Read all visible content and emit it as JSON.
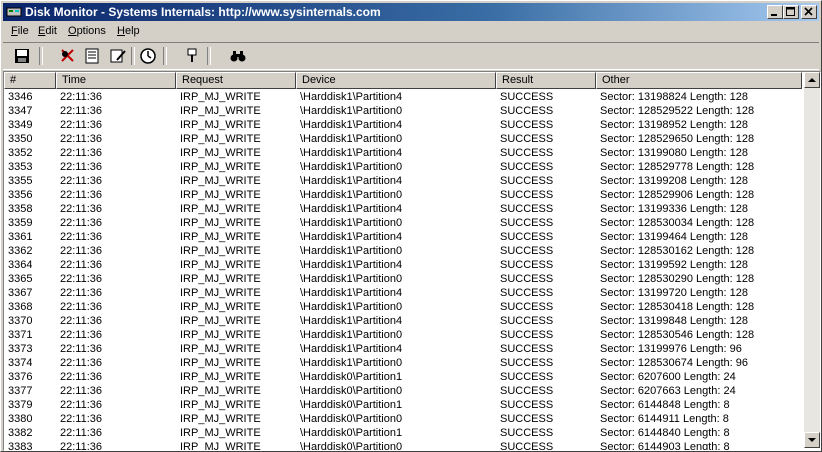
{
  "window": {
    "title": "Disk Monitor - Systems Internals: http://www.sysinternals.com"
  },
  "menu": [
    {
      "label": "File",
      "accel": "F",
      "rest": "ile"
    },
    {
      "label": "Edit",
      "accel": "E",
      "rest": "dit"
    },
    {
      "label": "Options",
      "accel": "O",
      "rest": "ptions"
    },
    {
      "label": "Help",
      "accel": "H",
      "rest": "elp"
    }
  ],
  "toolbar": [
    "save-icon",
    "capture-icon",
    "autoscroll-icon",
    "clear-icon",
    "time-icon",
    "filter-icon",
    "find-icon"
  ],
  "columns": [
    "#",
    "Time",
    "Request",
    "Device",
    "Result",
    "Other"
  ],
  "rows": [
    [
      "3346",
      "22:11:36",
      "IRP_MJ_WRITE",
      "\\Harddisk1\\Partition4",
      "SUCCESS",
      "Sector: 13198824  Length: 128"
    ],
    [
      "3347",
      "22:11:36",
      "IRP_MJ_WRITE",
      "\\Harddisk1\\Partition0",
      "SUCCESS",
      "Sector: 128529522  Length: 128"
    ],
    [
      "3349",
      "22:11:36",
      "IRP_MJ_WRITE",
      "\\Harddisk1\\Partition4",
      "SUCCESS",
      "Sector: 13198952  Length: 128"
    ],
    [
      "3350",
      "22:11:36",
      "IRP_MJ_WRITE",
      "\\Harddisk1\\Partition0",
      "SUCCESS",
      "Sector: 128529650  Length: 128"
    ],
    [
      "3352",
      "22:11:36",
      "IRP_MJ_WRITE",
      "\\Harddisk1\\Partition4",
      "SUCCESS",
      "Sector: 13199080  Length: 128"
    ],
    [
      "3353",
      "22:11:36",
      "IRP_MJ_WRITE",
      "\\Harddisk1\\Partition0",
      "SUCCESS",
      "Sector: 128529778  Length: 128"
    ],
    [
      "3355",
      "22:11:36",
      "IRP_MJ_WRITE",
      "\\Harddisk1\\Partition4",
      "SUCCESS",
      "Sector: 13199208  Length: 128"
    ],
    [
      "3356",
      "22:11:36",
      "IRP_MJ_WRITE",
      "\\Harddisk1\\Partition0",
      "SUCCESS",
      "Sector: 128529906  Length: 128"
    ],
    [
      "3358",
      "22:11:36",
      "IRP_MJ_WRITE",
      "\\Harddisk1\\Partition4",
      "SUCCESS",
      "Sector: 13199336  Length: 128"
    ],
    [
      "3359",
      "22:11:36",
      "IRP_MJ_WRITE",
      "\\Harddisk1\\Partition0",
      "SUCCESS",
      "Sector: 128530034  Length: 128"
    ],
    [
      "3361",
      "22:11:36",
      "IRP_MJ_WRITE",
      "\\Harddisk1\\Partition4",
      "SUCCESS",
      "Sector: 13199464  Length: 128"
    ],
    [
      "3362",
      "22:11:36",
      "IRP_MJ_WRITE",
      "\\Harddisk1\\Partition0",
      "SUCCESS",
      "Sector: 128530162  Length: 128"
    ],
    [
      "3364",
      "22:11:36",
      "IRP_MJ_WRITE",
      "\\Harddisk1\\Partition4",
      "SUCCESS",
      "Sector: 13199592  Length: 128"
    ],
    [
      "3365",
      "22:11:36",
      "IRP_MJ_WRITE",
      "\\Harddisk1\\Partition0",
      "SUCCESS",
      "Sector: 128530290  Length: 128"
    ],
    [
      "3367",
      "22:11:36",
      "IRP_MJ_WRITE",
      "\\Harddisk1\\Partition4",
      "SUCCESS",
      "Sector: 13199720  Length: 128"
    ],
    [
      "3368",
      "22:11:36",
      "IRP_MJ_WRITE",
      "\\Harddisk1\\Partition0",
      "SUCCESS",
      "Sector: 128530418  Length: 128"
    ],
    [
      "3370",
      "22:11:36",
      "IRP_MJ_WRITE",
      "\\Harddisk1\\Partition4",
      "SUCCESS",
      "Sector: 13199848  Length: 128"
    ],
    [
      "3371",
      "22:11:36",
      "IRP_MJ_WRITE",
      "\\Harddisk1\\Partition0",
      "SUCCESS",
      "Sector: 128530546  Length: 128"
    ],
    [
      "3373",
      "22:11:36",
      "IRP_MJ_WRITE",
      "\\Harddisk1\\Partition4",
      "SUCCESS",
      "Sector: 13199976  Length: 96"
    ],
    [
      "3374",
      "22:11:36",
      "IRP_MJ_WRITE",
      "\\Harddisk1\\Partition0",
      "SUCCESS",
      "Sector: 128530674  Length: 96"
    ],
    [
      "3376",
      "22:11:36",
      "IRP_MJ_WRITE",
      "\\Harddisk0\\Partition1",
      "SUCCESS",
      "Sector: 6207600  Length: 24"
    ],
    [
      "3377",
      "22:11:36",
      "IRP_MJ_WRITE",
      "\\Harddisk0\\Partition0",
      "SUCCESS",
      "Sector: 6207663  Length: 24"
    ],
    [
      "3379",
      "22:11:36",
      "IRP_MJ_WRITE",
      "\\Harddisk0\\Partition1",
      "SUCCESS",
      "Sector: 6144848  Length: 8"
    ],
    [
      "3380",
      "22:11:36",
      "IRP_MJ_WRITE",
      "\\Harddisk0\\Partition0",
      "SUCCESS",
      "Sector: 6144911  Length: 8"
    ],
    [
      "3382",
      "22:11:36",
      "IRP_MJ_WRITE",
      "\\Harddisk0\\Partition1",
      "SUCCESS",
      "Sector: 6144840  Length: 8"
    ],
    [
      "3383",
      "22:11:36",
      "IRP_MJ_WRITE",
      "\\Harddisk0\\Partition0",
      "SUCCESS",
      "Sector: 6144903  Length: 8"
    ]
  ]
}
